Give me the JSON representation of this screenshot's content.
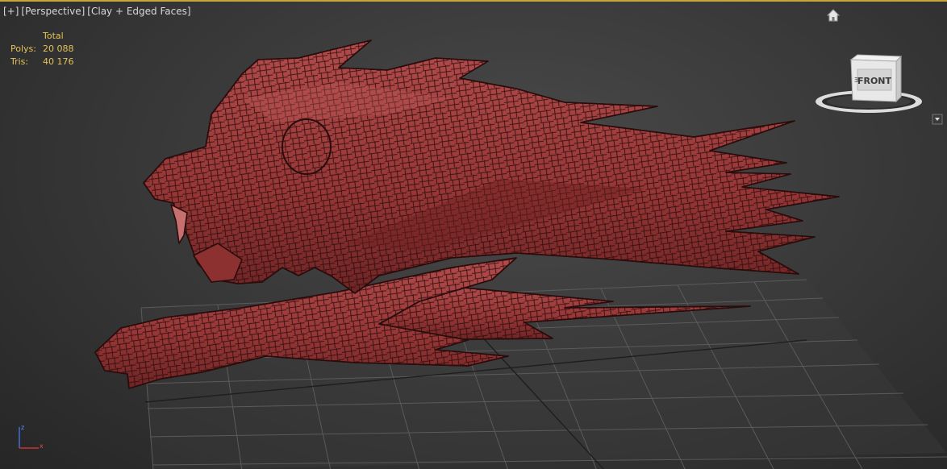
{
  "viewport": {
    "label_parts": [
      "[+]",
      "[Perspective]",
      "[Clay + Edged Faces]"
    ],
    "stats": {
      "header": "Total",
      "rows": [
        {
          "label": "Polys:",
          "value": "20 088"
        },
        {
          "label": "Tris:",
          "value": "40 176"
        }
      ]
    },
    "viewcube": {
      "face_label": "FRONT"
    },
    "axis": {
      "x": "x",
      "z": "z"
    },
    "colors": {
      "active_border": "#c6a53a",
      "stats_text": "#e2c35a",
      "clay": "#9a3a3a",
      "edges": "#2a0c0c",
      "grid": "#5a5a5a"
    },
    "icons": [
      "home-icon",
      "viewcube-icon",
      "viewcube-menu-icon",
      "axis-tripod-icon"
    ]
  }
}
